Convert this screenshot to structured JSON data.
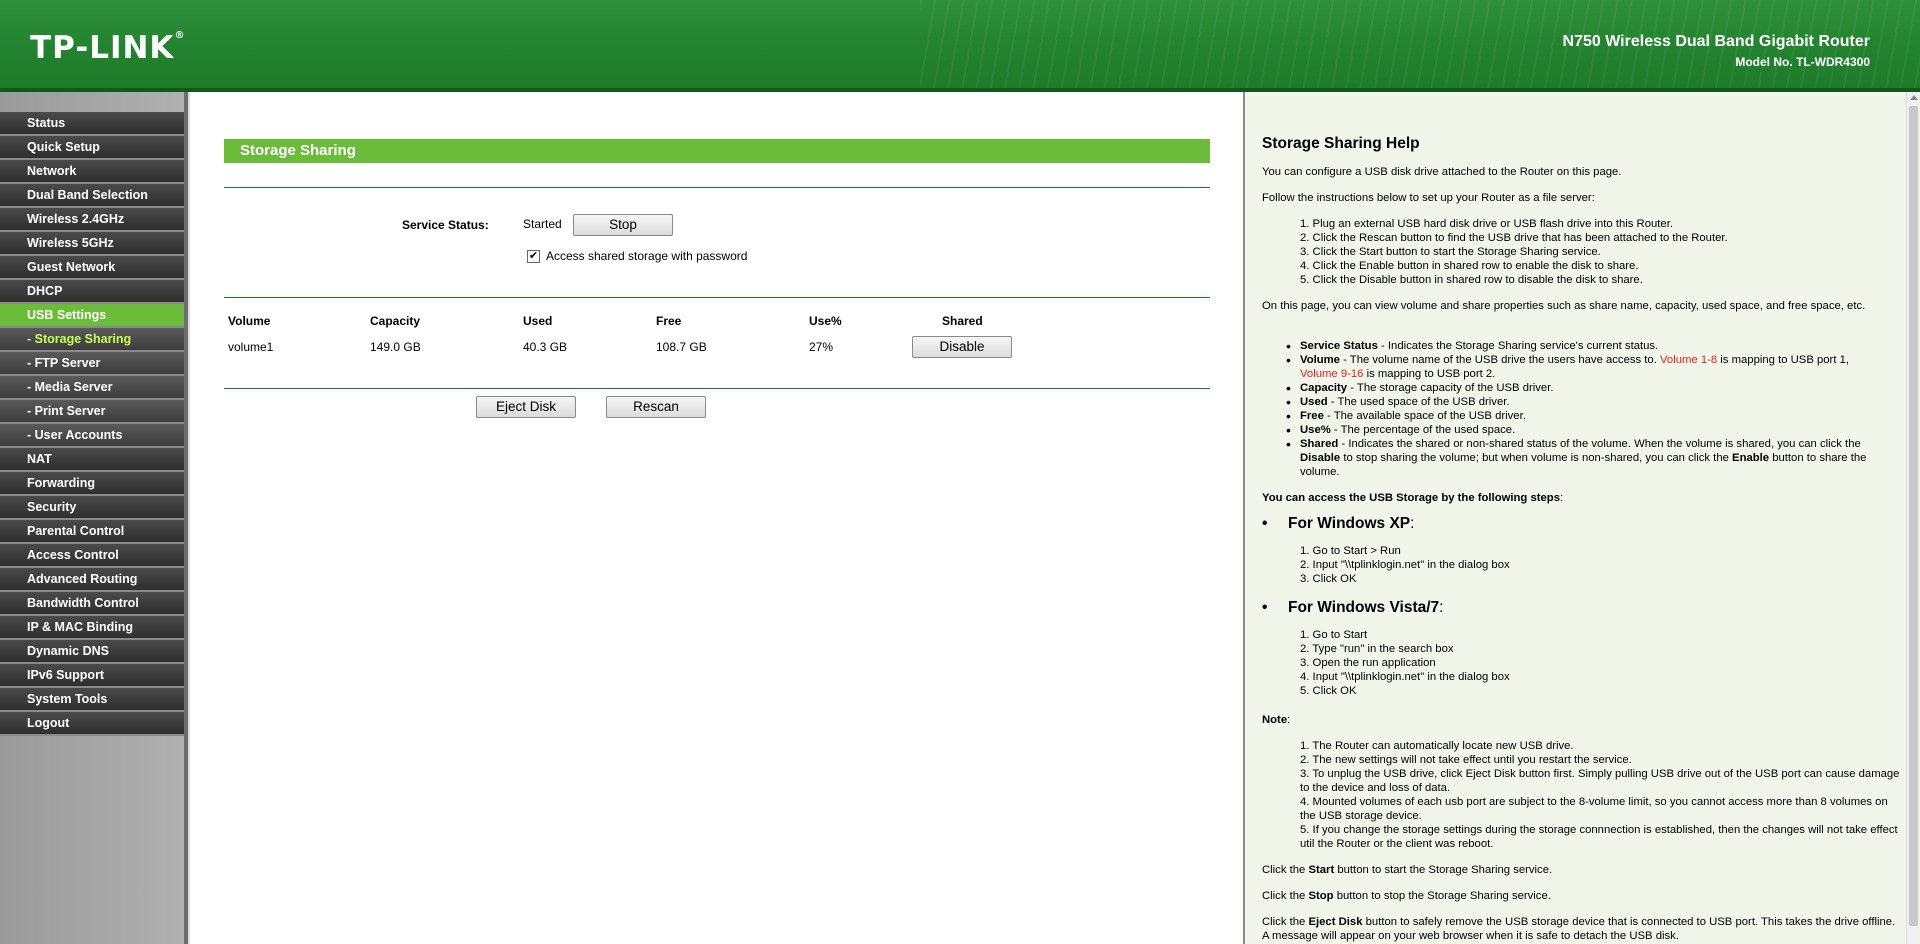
{
  "header": {
    "logo": "TP-LINK",
    "product_name": "N750 Wireless Dual Band Gigabit Router",
    "model_no": "Model No. TL-WDR4300"
  },
  "menu": [
    {
      "label": "Status"
    },
    {
      "label": "Quick Setup"
    },
    {
      "label": "Network"
    },
    {
      "label": "Dual Band Selection"
    },
    {
      "label": "Wireless 2.4GHz"
    },
    {
      "label": "Wireless 5GHz"
    },
    {
      "label": "Guest Network"
    },
    {
      "label": "DHCP"
    },
    {
      "label": "USB Settings",
      "active": true
    },
    {
      "label": "- Storage Sharing",
      "sub": true,
      "active": true
    },
    {
      "label": "- FTP Server",
      "sub": true
    },
    {
      "label": "- Media Server",
      "sub": true
    },
    {
      "label": "- Print Server",
      "sub": true
    },
    {
      "label": "- User Accounts",
      "sub": true
    },
    {
      "label": "NAT"
    },
    {
      "label": "Forwarding"
    },
    {
      "label": "Security"
    },
    {
      "label": "Parental Control"
    },
    {
      "label": "Access Control"
    },
    {
      "label": "Advanced Routing"
    },
    {
      "label": "Bandwidth Control"
    },
    {
      "label": "IP & MAC Binding"
    },
    {
      "label": "Dynamic DNS"
    },
    {
      "label": "IPv6 Support"
    },
    {
      "label": "System Tools"
    },
    {
      "label": "Logout"
    }
  ],
  "main": {
    "title": "Storage Sharing",
    "service_status_label": "Service Status:",
    "service_status_value": "Started",
    "stop_button": "Stop",
    "password_checkbox_label": "Access shared storage with password",
    "password_checked": true,
    "table": {
      "headers": [
        "Volume",
        "Capacity",
        "Used",
        "Free",
        "Use%",
        "Shared"
      ],
      "rows": [
        {
          "volume": "volume1",
          "capacity": "149.0 GB",
          "used": "40.3 GB",
          "free": "108.7 GB",
          "use_pct": "27%",
          "action": "Disable"
        }
      ]
    },
    "eject_button": "Eject Disk",
    "rescan_button": "Rescan"
  },
  "help": {
    "title": "Storage Sharing Help",
    "intro1": "You can configure a USB disk drive attached to the Router on this page.",
    "intro2": "Follow the instructions below to set up your Router as a file server:",
    "steps": [
      "1. Plug an external USB hard disk drive or USB flash drive into this Router.",
      "2. Click the Rescan button to find the USB drive that has been attached to the Router.",
      "3. Click the Start button to start the Storage Sharing service.",
      "4. Click the Enable button in shared row to enable the disk to share.",
      "5. Click the Disable button in shared row to disable the disk to share."
    ],
    "volume_info": "On this page, you can view volume and share properties such as share name, capacity, used space, and free space, etc.",
    "bullets": {
      "service_status_term": "Service Status",
      "service_status_text": " - Indicates the Storage Sharing service's current status.",
      "volume_term": "Volume",
      "volume_text_a": " - The volume name of the USB drive the users have access to. ",
      "volume_red1": "Volume 1-8",
      "volume_text_b": " is mapping to USB port 1,",
      "volume_red2": "Volume 9-16",
      "volume_text_c": " is mapping to USB port 2.",
      "capacity_term": "Capacity",
      "capacity_text": " - The storage capacity of the USB driver.",
      "used_term": "Used",
      "used_text": " - The used space of the USB driver.",
      "free_term": "Free",
      "free_text": " - The available space of the USB driver.",
      "use_term": "Use%",
      "use_text": " - The percentage of the used space.",
      "shared_term": "Shared",
      "shared_text_a": " - Indicates the shared or non-shared status of the volume. When the volume is shared, you can click the ",
      "shared_disable": "Disable",
      "shared_text_b": " to stop sharing the volume; but when volume is non-shared, you can click the ",
      "shared_enable": "Enable",
      "shared_text_c": " button to share the volume."
    },
    "access_heading": "You can access the USB Storage by the following steps",
    "access_colon": ":",
    "winxp_title": "For Windows XP",
    "winxp_colon": ":",
    "winxp_steps": [
      "1. Go to Start > Run",
      "2. Input \"\\\\tplinklogin.net\" in the dialog box",
      "3. Click OK"
    ],
    "vista_title": "For Windows Vista/7",
    "vista_colon": ":",
    "vista_steps": [
      "1. Go to Start",
      "2. Type \"run\" in the search box",
      "3. Open the run application",
      "4. Input \"\\\\tplinklogin.net\" in the dialog box",
      "5. Click OK"
    ],
    "note_title": "Note",
    "note_colon": ":",
    "notes": [
      "1. The Router can automatically locate new USB drive.",
      "2. The new settings will not take effect until you restart the service.",
      "3. To unplug the USB drive, click Eject Disk button first. Simply pulling USB drive out of the USB port can cause damage to the device and loss of data.",
      "4. Mounted volumes of each usb port are subject to the 8-volume limit, so you cannot access more than 8 volumes on the USB storage device.",
      "5. If you change the storage settings during the storage connnection is established, then the changes will not take effect util the Router or the client was reboot."
    ],
    "start_a": "Click the ",
    "start_term": "Start",
    "start_b": " button to start the Storage Sharing service.",
    "stop_a": "Click the ",
    "stop_term": "Stop",
    "stop_b": " button to stop the Storage Sharing service.",
    "eject_a": "Click the ",
    "eject_term": "Eject Disk",
    "eject_b": " button to safely remove the USB storage device that is connected to USB port. This takes the drive offline. A message will appear on your web browser when it is safe to detach the USB disk."
  }
}
